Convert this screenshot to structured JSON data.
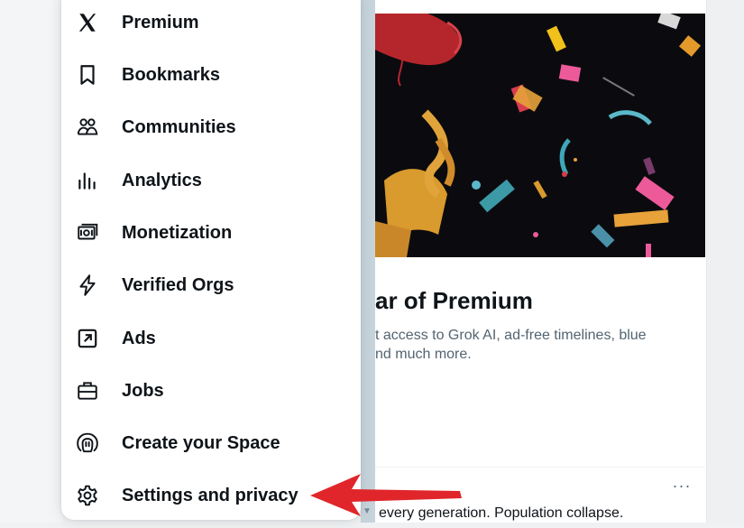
{
  "menu": {
    "items": [
      {
        "label": "Premium",
        "icon": "x-logo-icon"
      },
      {
        "label": "Bookmarks",
        "icon": "bookmark-icon"
      },
      {
        "label": "Communities",
        "icon": "communities-icon"
      },
      {
        "label": "Analytics",
        "icon": "analytics-icon"
      },
      {
        "label": "Monetization",
        "icon": "monetization-icon"
      },
      {
        "label": "Verified Orgs",
        "icon": "lightning-icon"
      },
      {
        "label": "Ads",
        "icon": "ads-arrow-icon"
      },
      {
        "label": "Jobs",
        "icon": "briefcase-icon"
      },
      {
        "label": "Create your Space",
        "icon": "microphone-icon"
      },
      {
        "label": "Settings and privacy",
        "icon": "gear-icon"
      }
    ]
  },
  "promo": {
    "title": "ar of Premium",
    "description_line1": "t access to Grok AI, ad-free timelines, blue",
    "description_line2": "nd much more."
  },
  "tweet": {
    "more": "···",
    "text": "every generation. Population collapse."
  },
  "colors": {
    "text": "#0f1419",
    "muted": "#536471",
    "annotation_arrow": "#e0262a"
  }
}
